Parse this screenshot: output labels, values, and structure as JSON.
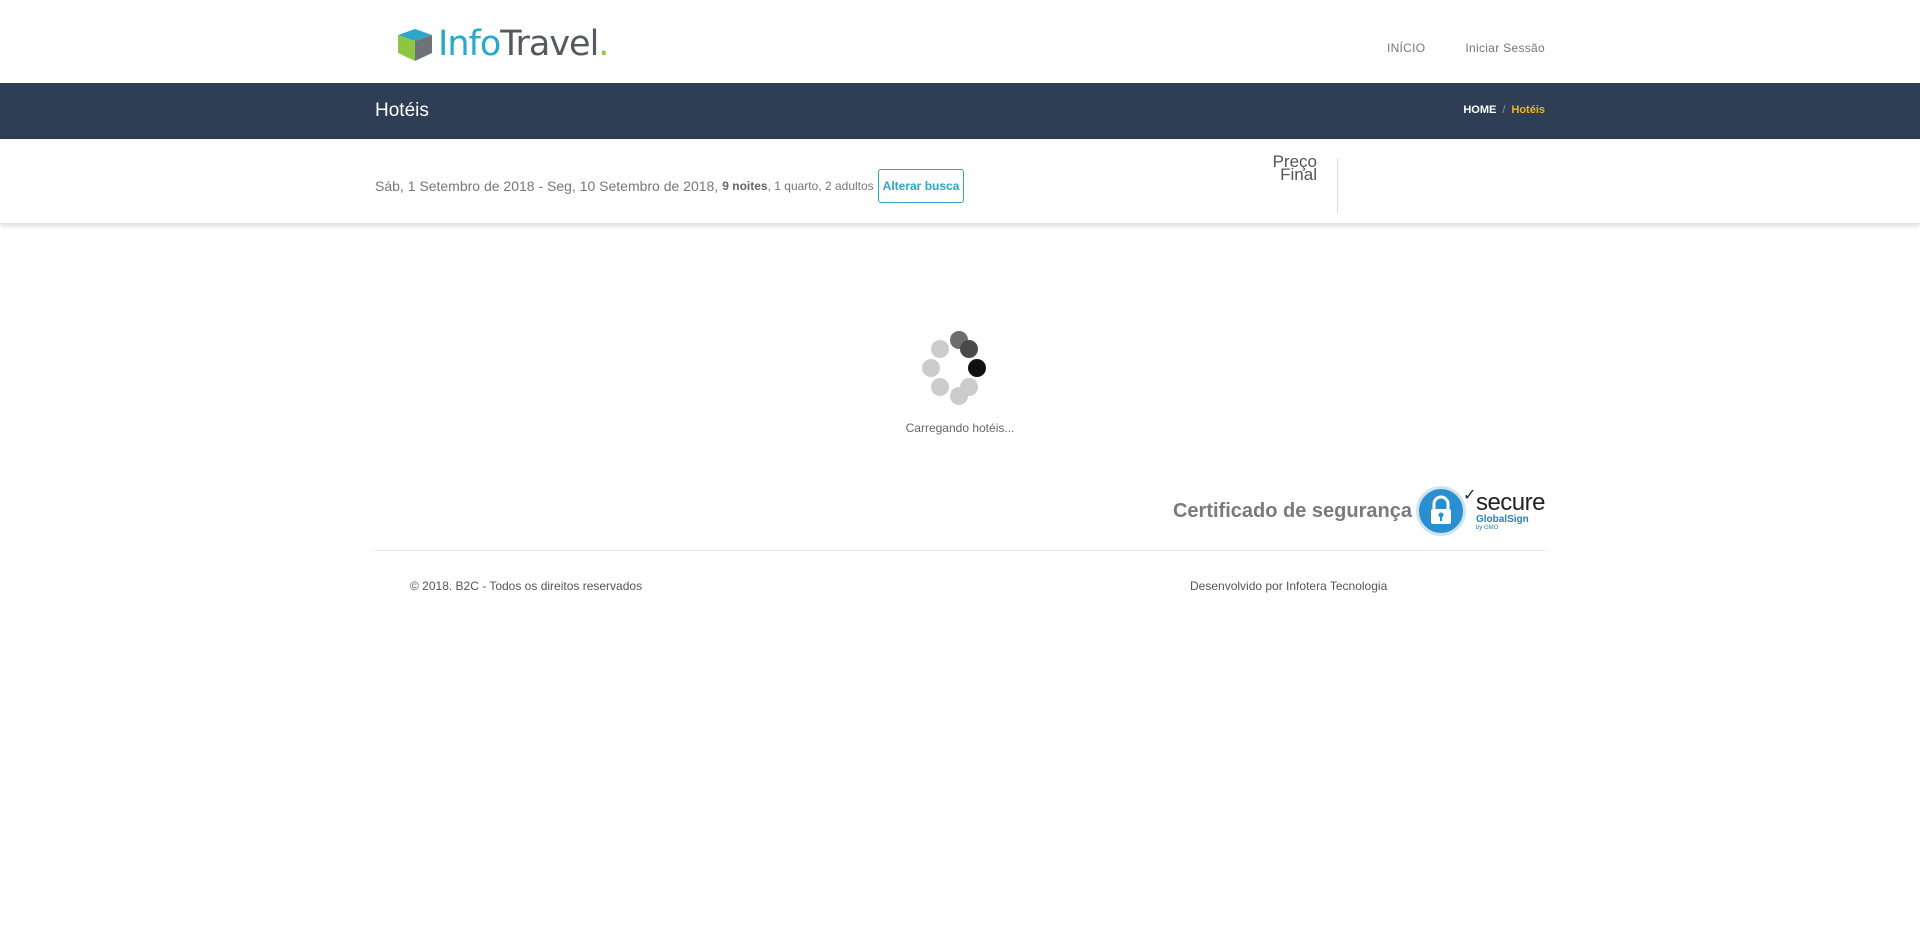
{
  "header": {
    "logo": {
      "part1": "Info",
      "part2": "Travel",
      "part3": "."
    },
    "nav": [
      {
        "label": "INÍCIO"
      },
      {
        "label": "Iniciar Sessão"
      }
    ]
  },
  "titlebar": {
    "title": "Hotéis",
    "breadcrumb": {
      "home": "HOME",
      "separator": "/",
      "current": "Hotéis"
    }
  },
  "search": {
    "dates": "Sáb, 1 Setembro de 2018 - Seg, 10 Setembro de 2018,",
    "nights": "9 noites",
    "rooms_guests": ", 1 quarto, 2 adultos",
    "alter_label": "Alterar busca",
    "price_label_line1": "Preço",
    "price_label_line2": "Final"
  },
  "loader": {
    "text": "Carregando hotéis..."
  },
  "security": {
    "label": "Certificado de segurança",
    "seal_secure": "secure",
    "seal_brand": "GlobalSign",
    "seal_gmo": "by GMO"
  },
  "footer": {
    "copyright": "© 2018. B2C - Todos os direitos reservados",
    "developed": "Desenvolvido por Infotera Tecnologia"
  },
  "colors": {
    "accent": "#29a8c7",
    "titlebar": "#2e3e55",
    "breadcrumb_active": "#f5b026"
  }
}
